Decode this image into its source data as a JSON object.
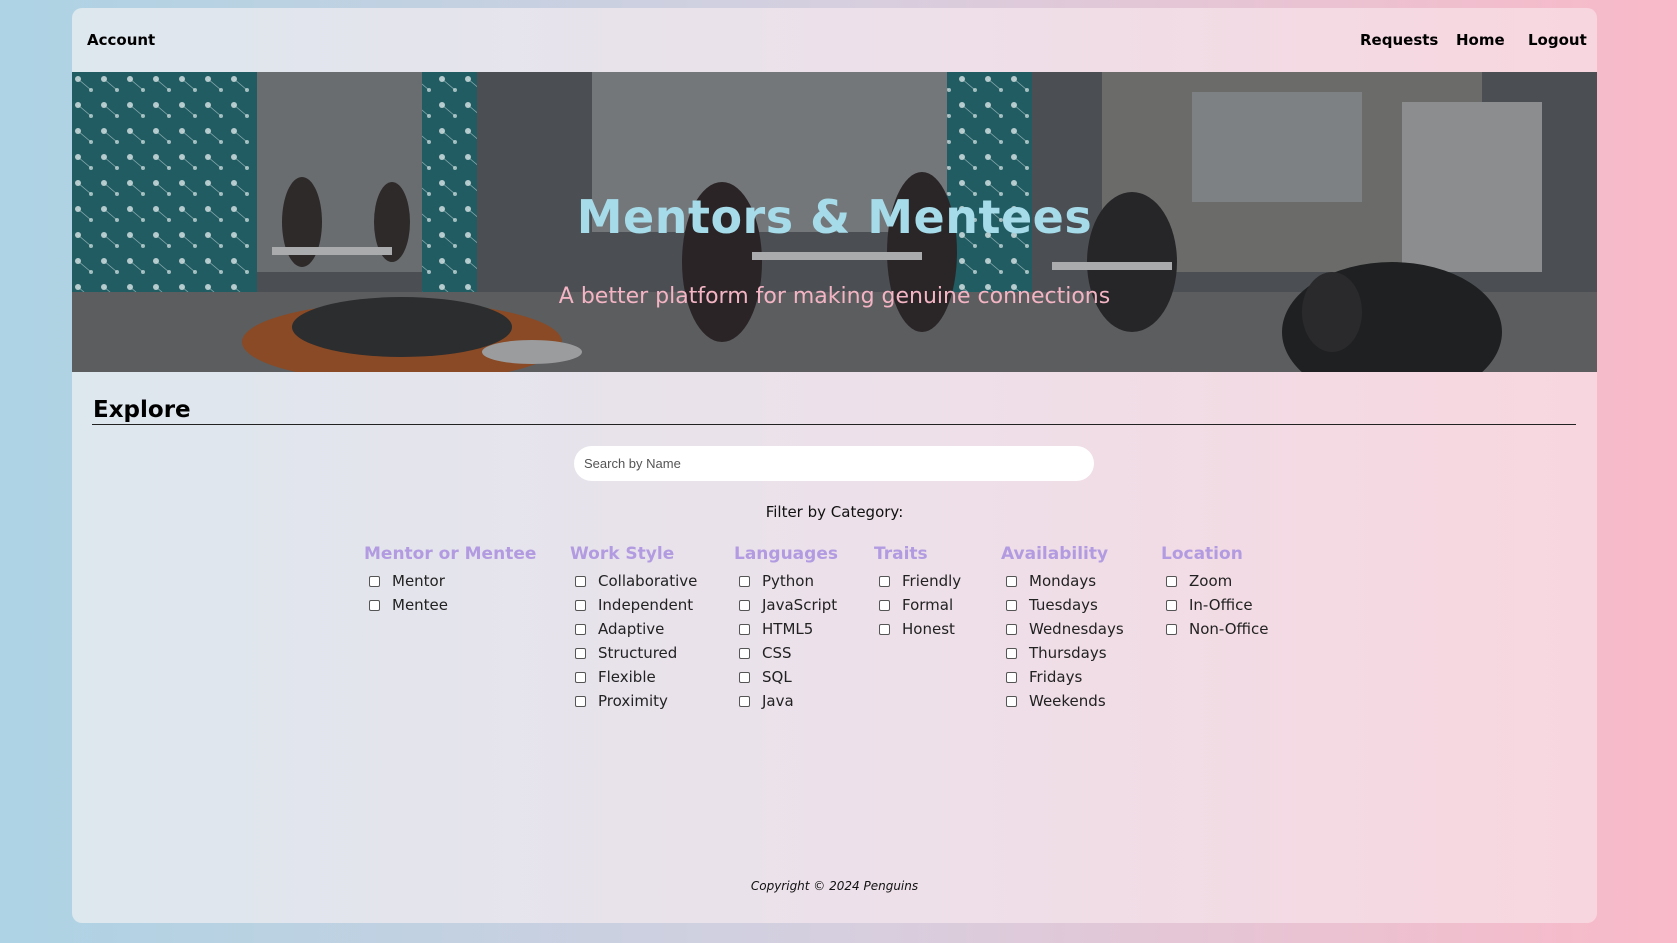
{
  "nav": {
    "account": "Account",
    "requests": "Requests",
    "home": "Home",
    "logout": "Logout"
  },
  "hero": {
    "title": "Mentors & Mentees",
    "subtitle": "A better platform for making genuine connections"
  },
  "explore": {
    "heading": "Explore",
    "search_placeholder": "Search by Name",
    "filter_label": "Filter by Category:"
  },
  "filters": [
    {
      "title": "Mentor or Mentee",
      "options": [
        "Mentor",
        "Mentee"
      ]
    },
    {
      "title": "Work Style",
      "options": [
        "Collaborative",
        "Independent",
        "Adaptive",
        "Structured",
        "Flexible",
        "Proximity"
      ]
    },
    {
      "title": "Languages",
      "options": [
        "Python",
        "JavaScript",
        "HTML5",
        "CSS",
        "SQL",
        "Java"
      ]
    },
    {
      "title": "Traits",
      "options": [
        "Friendly",
        "Formal",
        "Honest"
      ]
    },
    {
      "title": "Availability",
      "options": [
        "Mondays",
        "Tuesdays",
        "Wednesdays",
        "Thursdays",
        "Fridays",
        "Weekends"
      ]
    },
    {
      "title": "Location",
      "options": [
        "Zoom",
        "In-Office",
        "Non-Office"
      ]
    }
  ],
  "footer": {
    "copyright": "Copyright © 2024 Penguins"
  }
}
